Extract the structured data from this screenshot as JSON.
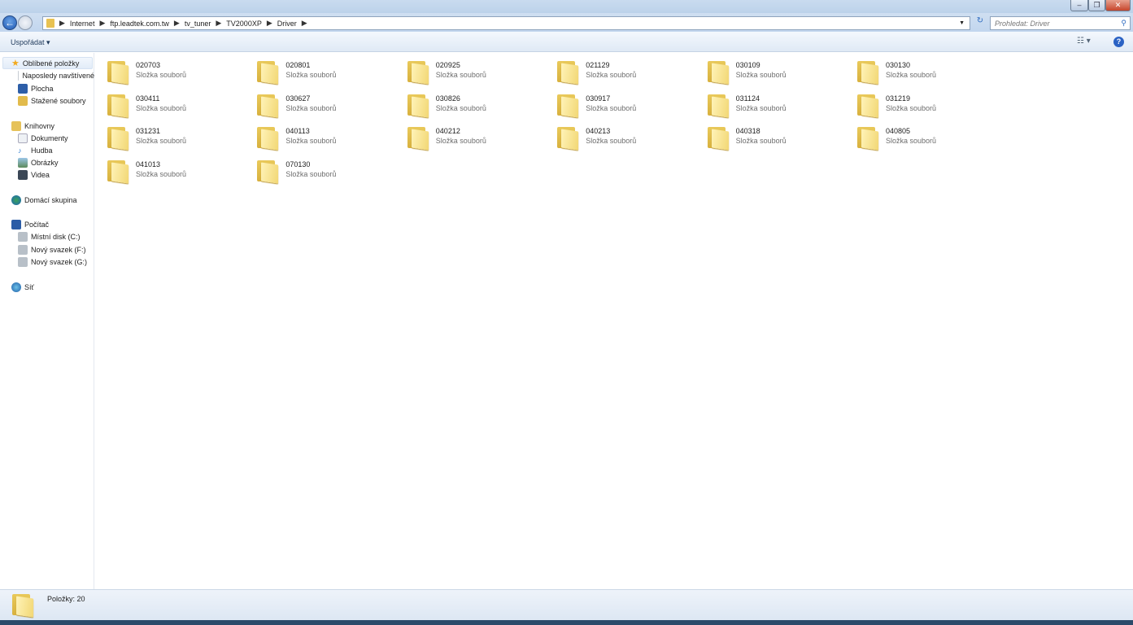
{
  "window": {
    "minimize": "–",
    "restore": "❐",
    "close": "✕"
  },
  "nav": {
    "back": "←",
    "breadcrumb": [
      "Internet",
      "ftp.leadtek.com.tw",
      "tv_tuner",
      "TV2000XP",
      "Driver"
    ],
    "search_placeholder": "Prohledat: Driver",
    "refresh": "↻",
    "search_icon": "⚲"
  },
  "toolbar": {
    "organize": "Uspořádat ▾",
    "views": "☷ ▾",
    "help": "?"
  },
  "sidebar": {
    "favorites": {
      "label": "Oblíbené položky",
      "items": [
        "Naposledy navštívené",
        "Plocha",
        "Stažené soubory"
      ]
    },
    "libraries": {
      "label": "Knihovny",
      "items": [
        "Dokumenty",
        "Hudba",
        "Obrázky",
        "Videa"
      ]
    },
    "homegroup": "Domácí skupina",
    "computer": {
      "label": "Počítač",
      "items": [
        "Místní disk (C:)",
        "Nový svazek (F:)",
        "Nový svazek (G:)"
      ]
    },
    "network": "Síť"
  },
  "folder_type": "Složka souborů",
  "folders": [
    "020703",
    "020801",
    "020925",
    "021129",
    "030109",
    "030130",
    "030411",
    "030627",
    "030826",
    "030917",
    "031124",
    "031219",
    "031231",
    "040113",
    "040212",
    "040213",
    "040318",
    "040805",
    "041013",
    "070130"
  ],
  "status": {
    "count": "Položky: 20"
  }
}
